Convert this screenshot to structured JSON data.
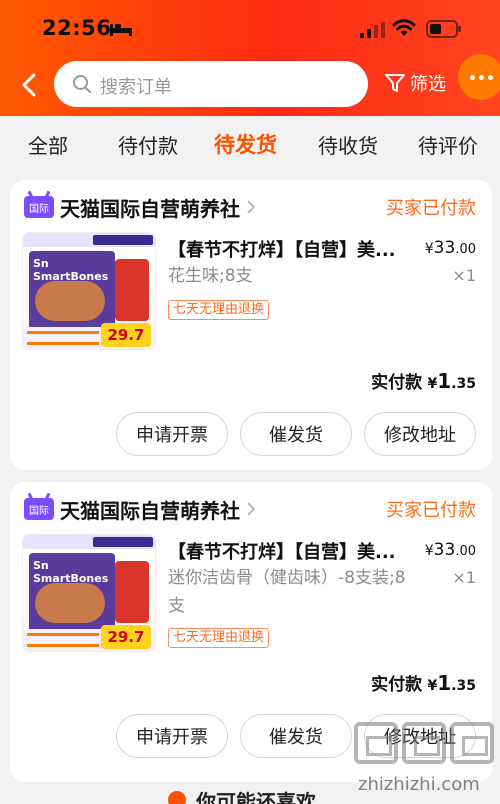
{
  "status_bar": {
    "time": "22:56"
  },
  "header": {
    "search_placeholder": "搜索订单",
    "filter_label": "筛选"
  },
  "tabs": [
    {
      "label": "全部"
    },
    {
      "label": "待付款"
    },
    {
      "label": "待发货"
    },
    {
      "label": "待收货"
    },
    {
      "label": "待评价"
    }
  ],
  "active_tab": "待发货",
  "orders": [
    {
      "shop_badge": "国际",
      "shop_name": "天猫国际自营萌养社",
      "status": "买家已付款",
      "title": "【春节不打烊】【自营】美...",
      "price_symbol": "¥",
      "price_int": "33",
      "price_dec": ".00",
      "spec": "花生味;8支",
      "qty": "×1",
      "return_policy": "七天无理由退换",
      "paid_label": "实付款",
      "paid_symbol": "¥",
      "paid_int": "1",
      "paid_dec": ".35",
      "thumb_price": "29.7",
      "buttons": {
        "invoice": "申请开票",
        "urge": "催发货",
        "address": "修改地址"
      }
    },
    {
      "shop_badge": "国际",
      "shop_name": "天猫国际自营萌养社",
      "status": "买家已付款",
      "title": "【春节不打烊】【自营】美...",
      "price_symbol": "¥",
      "price_int": "33",
      "price_dec": ".00",
      "spec": "迷你洁齿骨（健齿味）-8支装;8支",
      "qty": "×1",
      "return_policy": "七天无理由退换",
      "paid_label": "实付款",
      "paid_symbol": "¥",
      "paid_int": "1",
      "paid_dec": ".35",
      "thumb_price": "29.7",
      "buttons": {
        "invoice": "申请开票",
        "urge": "催发货",
        "address": "修改地址"
      }
    }
  ],
  "bottom_hint": "你可能还喜欢",
  "watermark": "zhizhizhi.com",
  "colors": {
    "accent": "#ff5000",
    "header_start": "#ff5a00",
    "header_end": "#ff2a12",
    "tmall_purple": "#7b4dff"
  }
}
